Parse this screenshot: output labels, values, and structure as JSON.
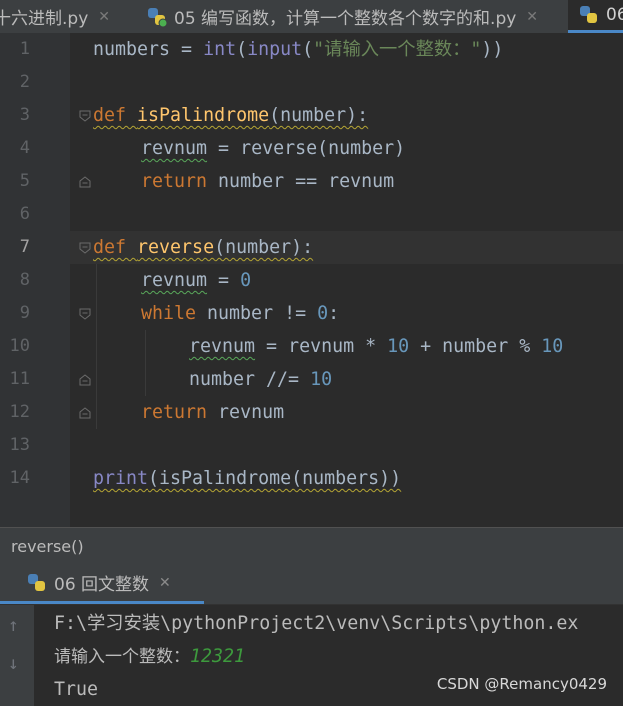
{
  "tabs": [
    {
      "label": "十六进制.py",
      "active": false
    },
    {
      "label": "05 编写函数，计算一个整数各个数字的和.py",
      "active": false
    },
    {
      "label": "06",
      "active": true
    }
  ],
  "editor": {
    "lines": [
      "1",
      "2",
      "3",
      "4",
      "5",
      "6",
      "7",
      "8",
      "9",
      "10",
      "11",
      "12",
      "13",
      "14"
    ],
    "current_line": "7",
    "code": {
      "l1": {
        "a": "numbers = ",
        "b": "int",
        "c": "(",
        "d": "input",
        "e": "(",
        "f": "\"请输入一个整数：\"",
        "g": "))"
      },
      "l3": {
        "kw": "def ",
        "fn": "isPalindrome",
        "rest": "(number):"
      },
      "l4": {
        "a": "revnum",
        "b": " = reverse(number)"
      },
      "l5": {
        "kw": "return",
        "rest": " number == revnum"
      },
      "l7": {
        "kw": "def ",
        "fn": "reverse",
        "rest": "(number):"
      },
      "l8": {
        "a": "revnum",
        "b": " = ",
        "n": "0"
      },
      "l9": {
        "kw": "while",
        "rest": " number != ",
        "n": "0",
        "end": ":"
      },
      "l10": {
        "a": "revnum",
        "b": " = revnum * ",
        "n1": "10",
        "c": " + number % ",
        "n2": "10"
      },
      "l11": {
        "a": "number //= ",
        "n": "10"
      },
      "l12": {
        "kw": "return",
        "rest": " revnum"
      },
      "l14": {
        "bi": "print",
        "rest": "(isPalindrome(numbers))"
      }
    }
  },
  "breadcrumb": "reverse()",
  "run_tab": {
    "label": "06 回文整数"
  },
  "console": {
    "cmd": "F:\\学习安装\\pythonProject2\\venv\\Scripts\\python.ex",
    "prompt": "请输入一个整数：",
    "input": "12321",
    "result": "True"
  },
  "watermark": "CSDN @Remancy0429",
  "colors": {
    "keyword": "#cc7832",
    "function": "#ffc66d",
    "number": "#6897bb",
    "string": "#6a8759",
    "builtin": "#8888c6"
  }
}
